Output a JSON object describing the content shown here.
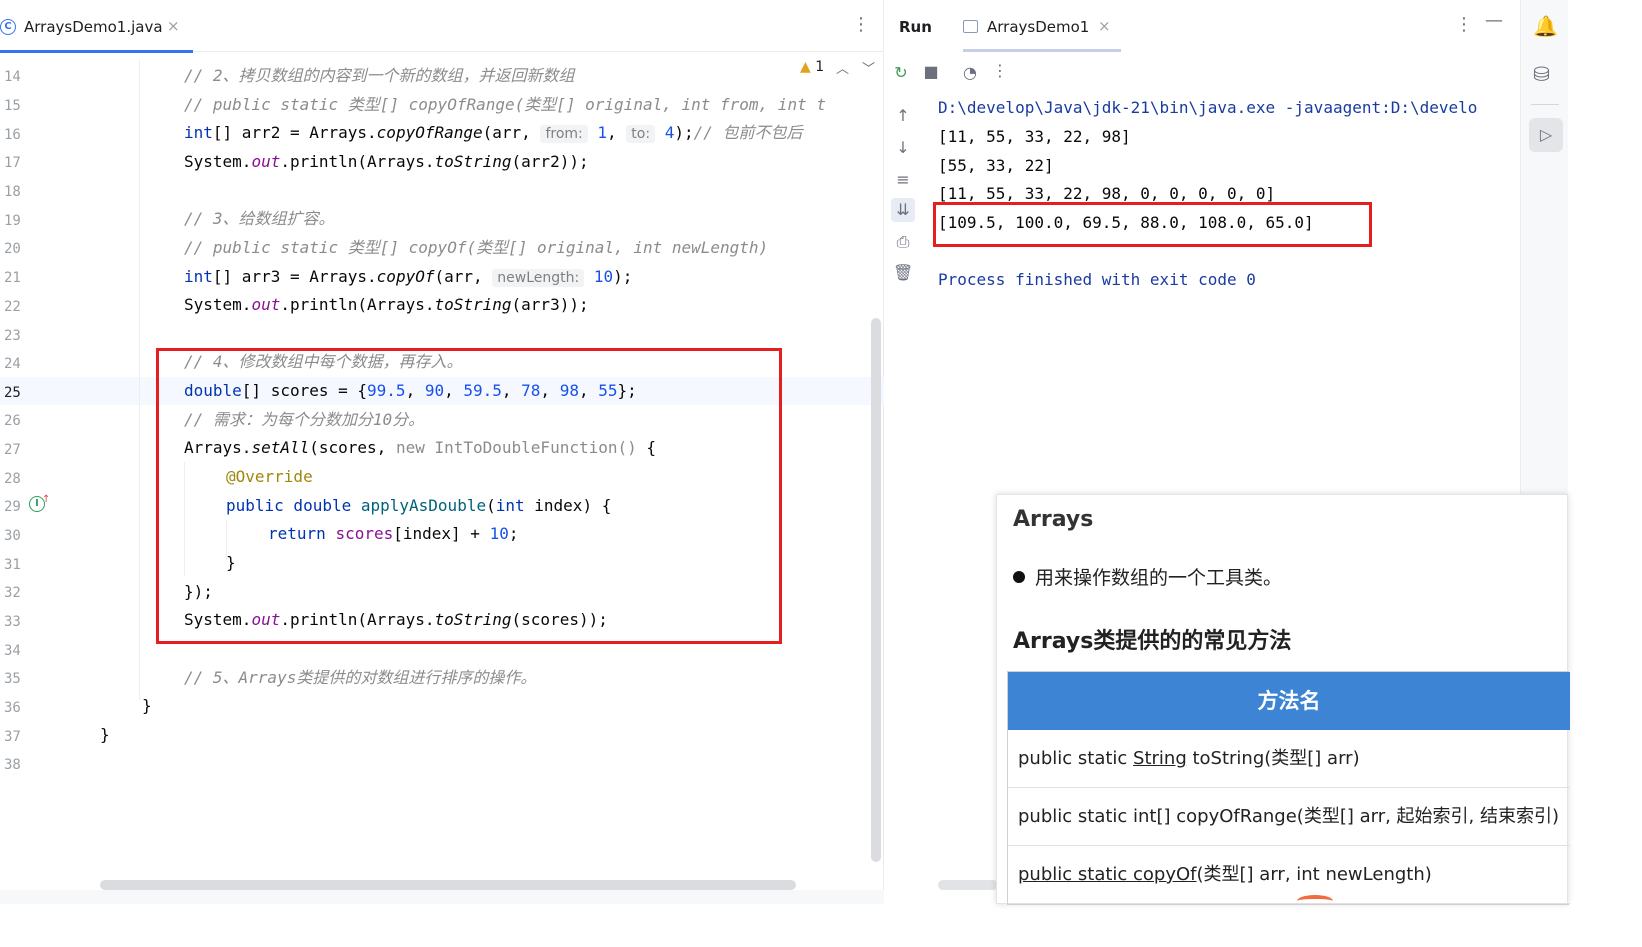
{
  "editor": {
    "tab_title": "ArraysDemo1.java",
    "tab_close": "×",
    "file_icon_letter": "C",
    "warning_count": "1",
    "line_numbers": [
      "14",
      "15",
      "16",
      "17",
      "18",
      "19",
      "20",
      "21",
      "22",
      "23",
      "24",
      "25",
      "26",
      "27",
      "28",
      "29",
      "30",
      "31",
      "32",
      "33",
      "34",
      "35",
      "36",
      "37",
      "38"
    ],
    "current_line": "25",
    "code": {
      "l14": "// 2、拷贝数组的内容到一个新的数组，并返回新数组",
      "l15": "// public static 类型[] copyOfRange(类型[] original, int from, int t",
      "l16_a": "int",
      "l16_b": "[] arr2 = Arrays.",
      "l16_c": "copyOfRange",
      "l16_d": "(arr, ",
      "l16_hint1": "from:",
      "l16_e": "1",
      "l16_f": ", ",
      "l16_hint2": "to:",
      "l16_g": "4",
      "l16_h": ");",
      "l16_cm": "// 包前不包后",
      "l17_a": "System.",
      "l17_b": "out",
      "l17_c": ".println(Arrays.",
      "l17_d": "toString",
      "l17_e": "(arr2));",
      "l19": "// 3、给数组扩容。",
      "l20": "// public static 类型[] copyOf(类型[] original, int newLength)",
      "l21_a": "int",
      "l21_b": "[] arr3 = Arrays.",
      "l21_c": "copyOf",
      "l21_d": "(arr, ",
      "l21_hint": "newLength:",
      "l21_e": "10",
      "l21_f": ");",
      "l22_a": "System.",
      "l22_b": "out",
      "l22_c": ".println(Arrays.",
      "l22_d": "toString",
      "l22_e": "(arr3));",
      "l24": "// 4、修改数组中每个数据，再存入。",
      "l25_a": "double",
      "l25_b": "[] scores = {",
      "l25_n1": "99.5",
      "l25_n2": "90",
      "l25_n3": "59.5",
      "l25_n4": "78",
      "l25_n5": "98",
      "l25_n6": "55",
      "l25_end": "};",
      "l26": "// 需求：为每个分数加分10分。",
      "l27_a": "Arrays.",
      "l27_b": "setAll",
      "l27_c": "(scores, ",
      "l27_d": "new IntToDoubleFunction()",
      "l27_e": " {",
      "l28": "@Override",
      "l29_a": "public double ",
      "l29_b": "applyAsDouble",
      "l29_c": "(",
      "l29_d": "int",
      "l29_e": " index) {",
      "l30_a": "return ",
      "l30_b": "scores",
      "l30_c": "[index] + ",
      "l30_d": "10",
      "l30_e": ";",
      "l31": "}",
      "l32": "});",
      "l33_a": "System.",
      "l33_b": "out",
      "l33_c": ".println(Arrays.",
      "l33_d": "toString",
      "l33_e": "(scores));",
      "l35": "// 5、Arrays类提供的对数组进行排序的操作。",
      "l36": "}",
      "l37": "}"
    }
  },
  "run": {
    "label": "Run",
    "tab_title": "ArraysDemo1",
    "tab_close": "×",
    "console": [
      "D:\\develop\\Java\\jdk-21\\bin\\java.exe -javaagent:D:\\develo",
      "[11, 55, 33, 22, 98]",
      "[55, 33, 22]",
      "[11, 55, 33, 22, 98, 0, 0, 0, 0, 0]",
      "[109.5, 100.0, 69.5, 88.0, 108.0, 65.0]",
      "Process finished with exit code 0"
    ]
  },
  "slide": {
    "title": "Arrays",
    "bullet": "用来操作数组的一个工具类。",
    "subtitle": "Arrays类提供的的常见方法",
    "table_header": "方法名",
    "rows": {
      "r1_a": "public static ",
      "r1_b": "String",
      "r1_c": " toString(类型[] arr)",
      "r2": "public static int[] copyOfRange(类型[] arr, 起始索引, 结束索引)",
      "r3_a": "public static copyOf",
      "r3_b": "(类型[] arr, int newLength)"
    }
  },
  "colors": {
    "accent": "#3574f0",
    "highlight_box": "#e51e1e",
    "slide_header": "#3d84d4",
    "keyword": "#0033b3",
    "number": "#1750eb"
  }
}
